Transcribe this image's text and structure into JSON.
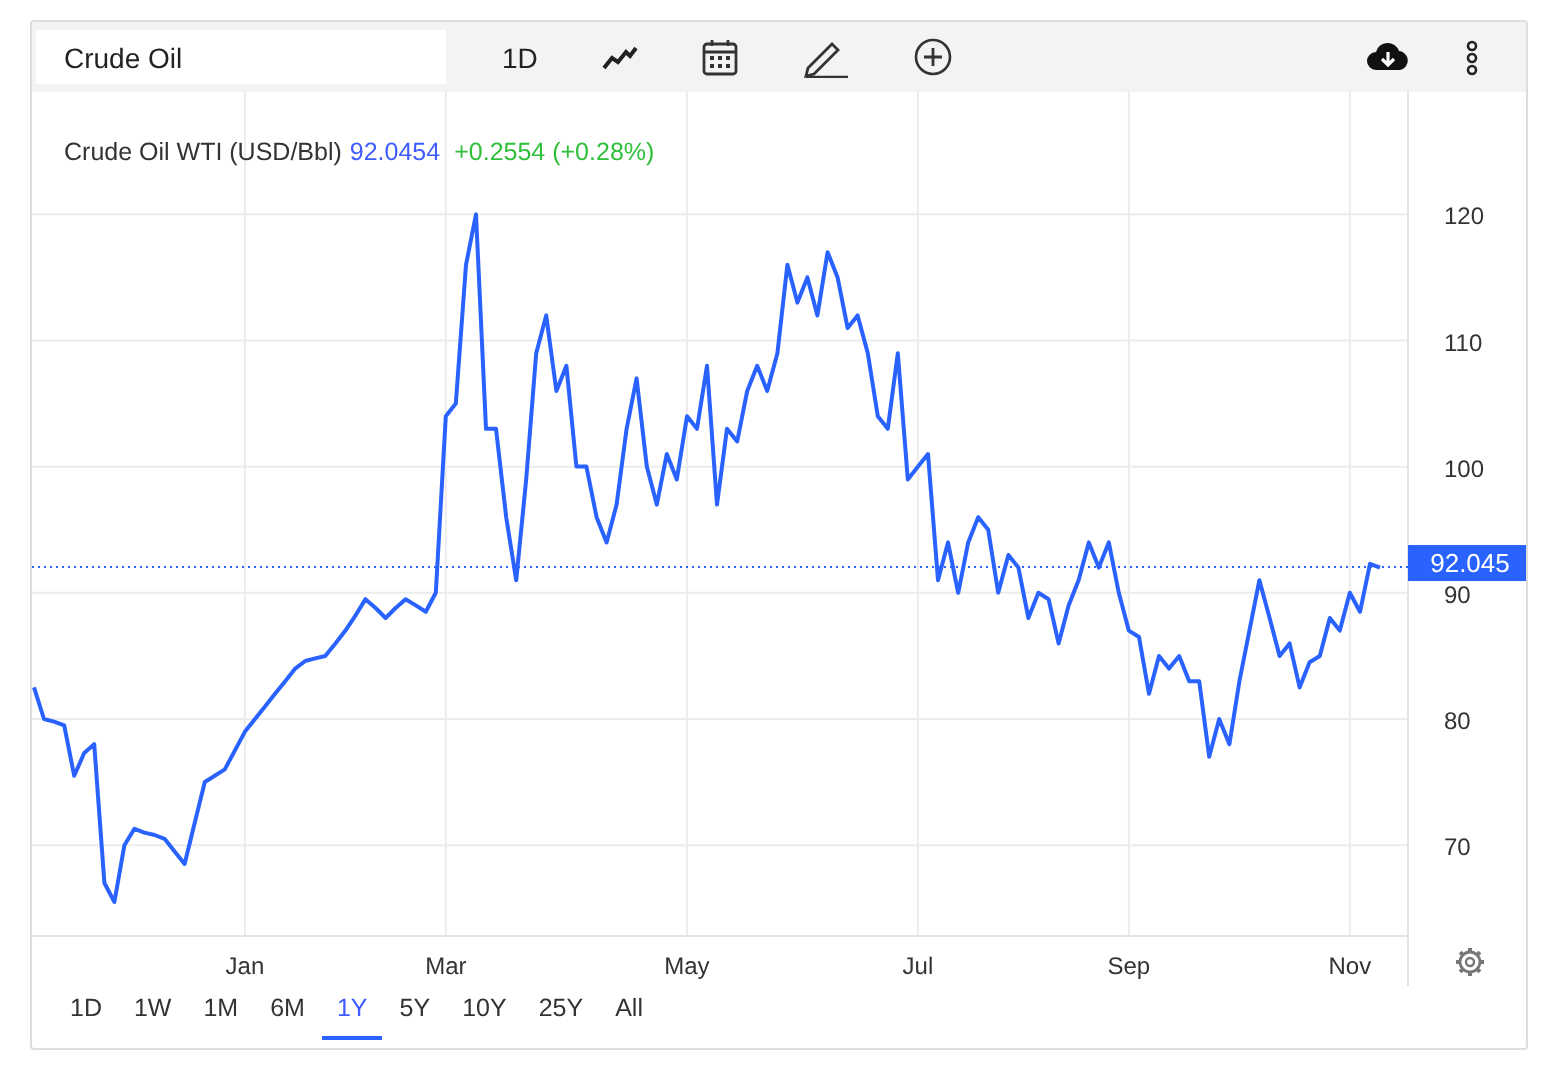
{
  "toolbar": {
    "search_value": "Crude Oil",
    "interval": "1D"
  },
  "header": {
    "name": "Crude Oil WTI (USD/Bbl)",
    "price": "92.0454",
    "change": "+0.2554 (+0.28%)"
  },
  "chart": {
    "price_tag": "92.045",
    "chart_data": {
      "type": "line",
      "grid": true,
      "ref_lines": [
        {
          "axis": "y",
          "value": 92.045
        }
      ],
      "ylim": [
        62.8,
        129.7
      ],
      "yticks": [
        70,
        80,
        90,
        100,
        110,
        120
      ],
      "categories": [
        null,
        null,
        null,
        null,
        null,
        null,
        null,
        null,
        null,
        null,
        null,
        null,
        null,
        null,
        null,
        null,
        null,
        null,
        null,
        null,
        null,
        "Jan",
        null,
        null,
        null,
        null,
        null,
        null,
        null,
        null,
        null,
        null,
        null,
        null,
        null,
        null,
        null,
        null,
        null,
        null,
        null,
        "Mar",
        null,
        null,
        null,
        null,
        null,
        null,
        null,
        null,
        null,
        null,
        null,
        null,
        null,
        null,
        null,
        null,
        null,
        null,
        null,
        null,
        null,
        null,
        null,
        "May",
        null,
        null,
        null,
        null,
        null,
        null,
        null,
        null,
        null,
        null,
        null,
        null,
        null,
        null,
        null,
        null,
        null,
        null,
        null,
        null,
        null,
        null,
        "Jul",
        null,
        null,
        null,
        null,
        null,
        null,
        null,
        null,
        null,
        null,
        null,
        null,
        null,
        null,
        null,
        null,
        null,
        null,
        null,
        null,
        "Sep",
        null,
        null,
        null,
        null,
        null,
        null,
        null,
        null,
        null,
        null,
        null,
        null,
        null,
        null,
        null,
        null,
        null,
        null,
        null,
        null,
        null,
        "Nov",
        null,
        null,
        null
      ],
      "series": [
        {
          "color": "#2962ff",
          "values": [
            82.5,
            80,
            79.8,
            79.5,
            75.5,
            77.3,
            78,
            67,
            65.5,
            70,
            71.3,
            71,
            70.8,
            70.5,
            69.5,
            68.5,
            71.8,
            75,
            75.5,
            76,
            77.5,
            79,
            80,
            81,
            82,
            83,
            84,
            84.6,
            84.8,
            85,
            86,
            87,
            88.2,
            89.5,
            88.8,
            88,
            88.8,
            89.5,
            89,
            88.5,
            90,
            104,
            105,
            116,
            120,
            103,
            103,
            96,
            91,
            99,
            109,
            112,
            106,
            108,
            100,
            100,
            96,
            94,
            97,
            103,
            107,
            100,
            97,
            101,
            99,
            104,
            103,
            108,
            97,
            103,
            102,
            106,
            108,
            106,
            109,
            116,
            113,
            115,
            112,
            117,
            115,
            111,
            112,
            109,
            104,
            103,
            109,
            99,
            100,
            101,
            91,
            94,
            90,
            94,
            96,
            95,
            90,
            93,
            92,
            88,
            90,
            89.5,
            86,
            89,
            91,
            94,
            92,
            94,
            90,
            87,
            86.5,
            82,
            85,
            84,
            85,
            83,
            83,
            77,
            80,
            78,
            83,
            87,
            91,
            88,
            85,
            86,
            82.5,
            84.5,
            85,
            88,
            87,
            90,
            88.5,
            92.3,
            92
          ]
        }
      ]
    }
  },
  "ranges": [
    {
      "label": "1D",
      "selected": false
    },
    {
      "label": "1W",
      "selected": false
    },
    {
      "label": "1M",
      "selected": false
    },
    {
      "label": "6M",
      "selected": false
    },
    {
      "label": "1Y",
      "selected": true
    },
    {
      "label": "5Y",
      "selected": false
    },
    {
      "label": "10Y",
      "selected": false
    },
    {
      "label": "25Y",
      "selected": false
    },
    {
      "label": "All",
      "selected": false
    }
  ]
}
